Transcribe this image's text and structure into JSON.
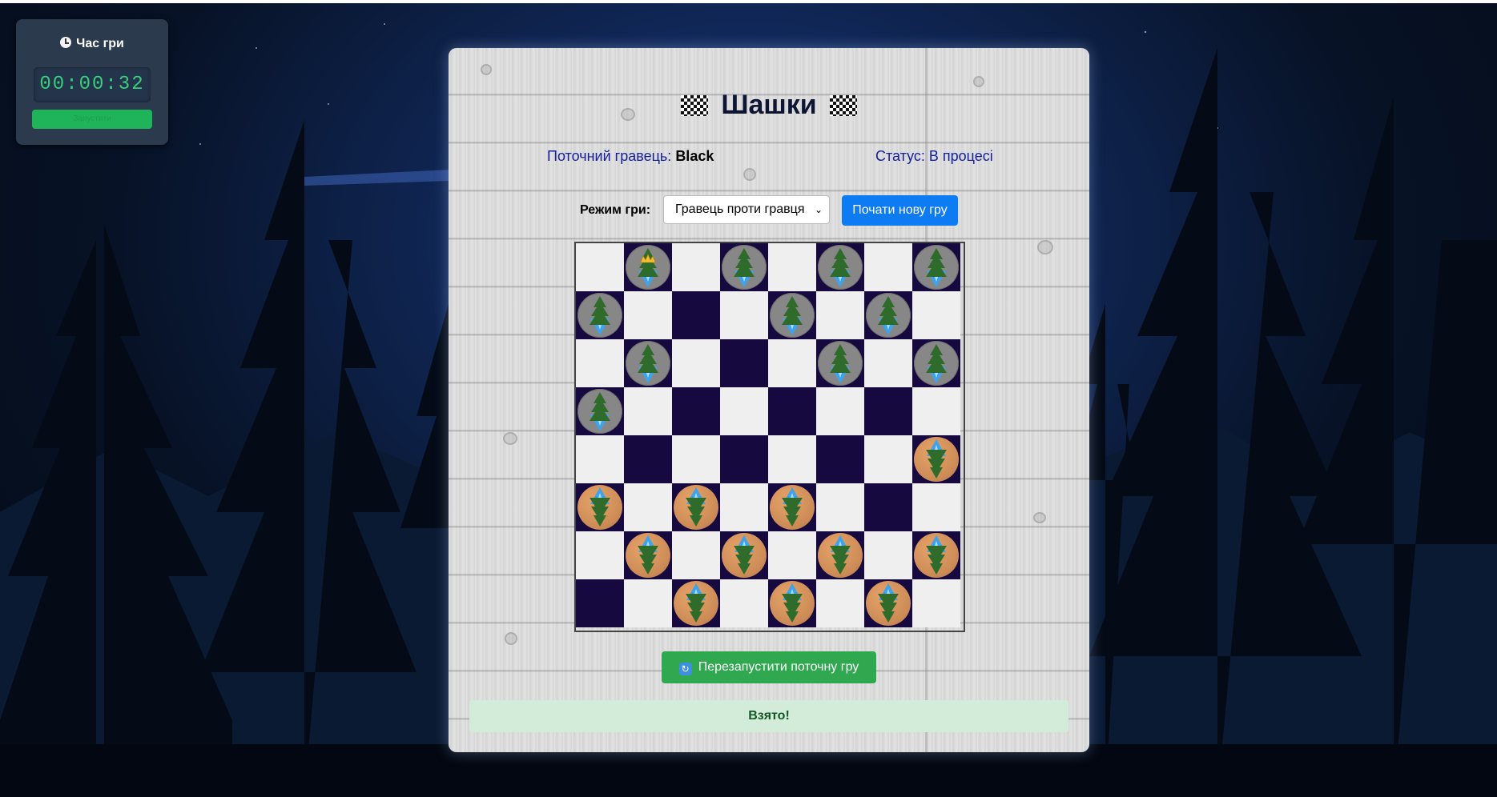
{
  "timer": {
    "title": "Час гри",
    "value": "00:00:32",
    "button_label": "Запустити"
  },
  "game": {
    "title": "Шашки",
    "current_player_label": "Поточний гравець:",
    "current_player": "Black",
    "status": "Статус: В процесі",
    "mode_label": "Режим гри:",
    "mode_selected": "Гравець проти гравця",
    "new_game_label": "Почати нову гру",
    "restart_label": "Перезапустити поточну гру",
    "message": "Взято!"
  },
  "board": {
    "rows": [
      [
        "",
        "BK",
        "",
        "B",
        "",
        "B",
        "",
        "B"
      ],
      [
        "B",
        "",
        "",
        "",
        "B",
        "",
        "B",
        ""
      ],
      [
        "",
        "B",
        "",
        "",
        "",
        "B",
        "",
        "B"
      ],
      [
        "B",
        "",
        "",
        "",
        "",
        "",
        "",
        ""
      ],
      [
        "",
        "",
        "",
        "",
        "",
        "",
        "",
        "W"
      ],
      [
        "W",
        "",
        "W",
        "",
        "W",
        "",
        "",
        ""
      ],
      [
        "",
        "W",
        "",
        "W",
        "",
        "W",
        "",
        "W"
      ],
      [
        "",
        "",
        "W",
        "",
        "W",
        "",
        "W",
        ""
      ]
    ],
    "legend": {
      "B": "black-piece",
      "BK": "black-king",
      "W": "white-piece"
    },
    "colors": {
      "light": "#efefef",
      "dark": "#15093f",
      "black_piece": "#878787",
      "white_piece": "#cb8a55"
    }
  }
}
